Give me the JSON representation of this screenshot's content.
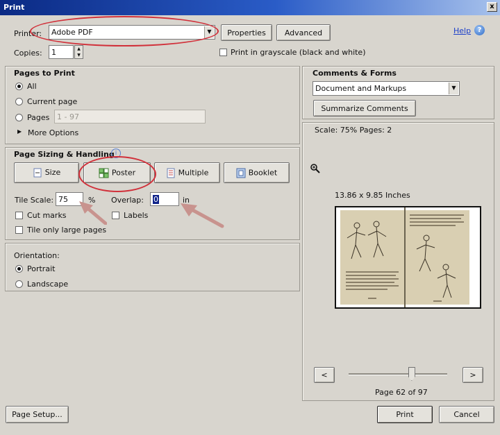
{
  "window": {
    "title": "Print",
    "close": "x"
  },
  "printer": {
    "label": "Printer:",
    "value": "Adobe PDF",
    "properties_label": "Properties",
    "advanced_label": "Advanced",
    "help_label": "Help",
    "copies_label": "Copies:",
    "copies_value": "1",
    "grayscale_label": "Print in grayscale (black and white)"
  },
  "pages": {
    "title": "Pages to Print",
    "all": "All",
    "current": "Current page",
    "pages": "Pages",
    "range": "1 - 97",
    "more": "More Options"
  },
  "sizing": {
    "title": "Page Sizing & Handling",
    "buttons": {
      "size": "Size",
      "poster": "Poster",
      "multiple": "Multiple",
      "booklet": "Booklet"
    },
    "tile_scale_label": "Tile Scale:",
    "tile_scale_value": "75",
    "tile_scale_unit": "%",
    "overlap_label": "Overlap:",
    "overlap_value": "0",
    "overlap_unit": "in",
    "cut_marks": "Cut marks",
    "labels": "Labels",
    "tile_large": "Tile only large pages"
  },
  "orientation": {
    "title": "Orientation:",
    "portrait": "Portrait",
    "landscape": "Landscape"
  },
  "comments": {
    "title": "Comments & Forms",
    "value": "Document and Markups",
    "summarize": "Summarize Comments"
  },
  "preview": {
    "scale_text": "Scale:  75% Pages: 2",
    "size_text": "13.86 x 9.85 Inches",
    "page_text": "Page 62 of 97",
    "prev": "<",
    "next": ">",
    "slider_fraction": 0.64
  },
  "footer": {
    "page_setup": "Page Setup...",
    "print": "Print",
    "cancel": "Cancel"
  },
  "colors": {
    "highlight": "#d1303a",
    "arrow": "#c8938e"
  }
}
